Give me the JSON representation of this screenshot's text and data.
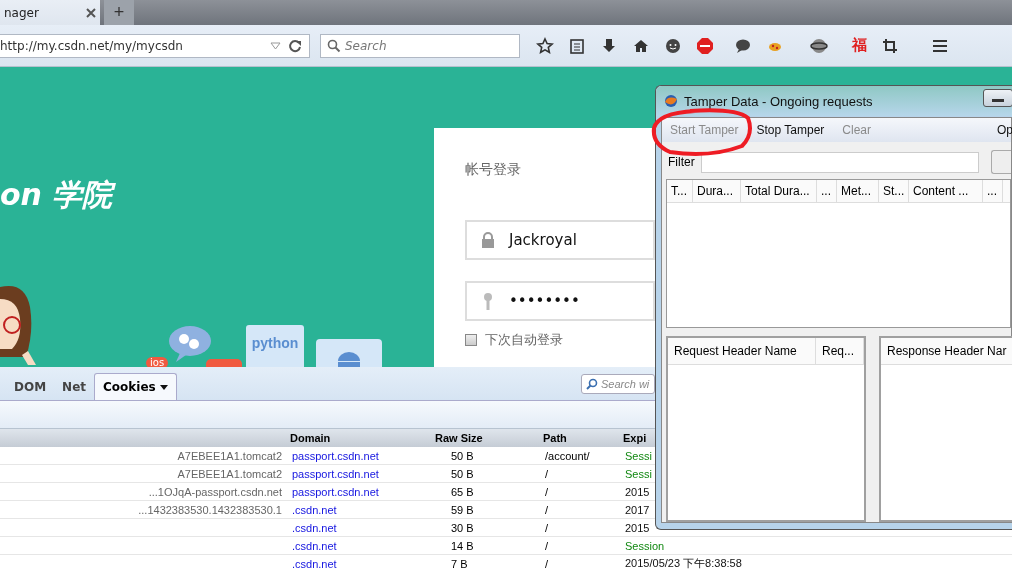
{
  "browser": {
    "tabs": [
      {
        "label": "nager",
        "selected": true
      }
    ],
    "new_tab": "+",
    "url": "http://my.csdn.net/my/mycsdn",
    "search_placeholder": "Search",
    "toolbar_glyph": "福"
  },
  "page": {
    "logo": "on 学院",
    "badge": "ios",
    "tile": "python",
    "login": {
      "title": "帐号登录",
      "username": "Jackroyal",
      "password": "••••••••",
      "remember": {
        "label": "下次自动登录",
        "checked": false
      }
    }
  },
  "devtools": {
    "tabs": [
      {
        "label": "DOM",
        "selected": false
      },
      {
        "label": "Net",
        "selected": false
      },
      {
        "label": "Cookies",
        "selected": true
      }
    ],
    "search_placeholder": "Search wi",
    "columns": [
      "Domain",
      "Raw Size",
      "Path",
      "Expi"
    ],
    "rows": [
      {
        "name": "A7EBEE1A1.tomcat2",
        "domain": "passport.csdn.net",
        "size": "50 B",
        "path": "/account/",
        "expires": "Sessi",
        "session": true
      },
      {
        "name": "A7EBEE1A1.tomcat2",
        "domain": "passport.csdn.net",
        "size": "50 B",
        "path": "/",
        "expires": "Sessi",
        "session": true
      },
      {
        "name": "...1OJqA-passport.csdn.net",
        "domain": "passport.csdn.net",
        "size": "65 B",
        "path": "/",
        "expires": "2015",
        "session": false
      },
      {
        "name": "...1432383530.1432383530.1",
        "domain": ".csdn.net",
        "size": "59 B",
        "path": "/",
        "expires": "2017",
        "session": false
      },
      {
        "domain": ".csdn.net",
        "size": "30 B",
        "path": "/",
        "expires": "2015",
        "session": false
      },
      {
        "domain": ".csdn.net",
        "size": "14 B",
        "path": "/",
        "expires": "Session",
        "session": true
      },
      {
        "domain": ".csdn.net",
        "size": "7 B",
        "path": "/",
        "expires": "2015/05/23 下午8:38:58",
        "session": false
      }
    ]
  },
  "tamper": {
    "title": "Tamper Data - Ongoing requests",
    "menu": [
      {
        "label": "Start Tamper",
        "disabled": true
      },
      {
        "label": "Stop Tamper",
        "disabled": false
      },
      {
        "label": "Clear",
        "disabled": true
      },
      {
        "label": "Op",
        "disabled": false
      }
    ],
    "filter_label": "Filter",
    "request_columns": [
      "T...",
      "Dura...",
      "Total Dura...",
      "...",
      "Met...",
      "St...",
      "Content ...",
      "..."
    ],
    "request_header_columns": [
      "Request Header Name",
      "Req..."
    ],
    "response_header_columns": [
      "Response Header Nar"
    ]
  }
}
